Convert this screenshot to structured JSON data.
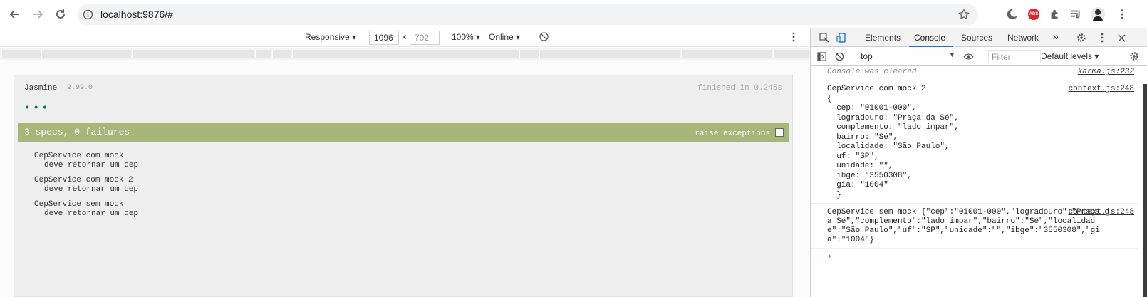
{
  "browser": {
    "url": "localhost:9876/#",
    "icons": [
      "back-icon",
      "forward-icon",
      "reload-icon",
      "info-icon",
      "star-icon",
      "dark-mode-icon",
      "adblock-icon",
      "extensions-icon",
      "media-icon",
      "profile-avatar",
      "menu-icon"
    ],
    "adblock_label": "ADS"
  },
  "device_toolbar": {
    "mode": "Responsive",
    "width": "1096",
    "times": "×",
    "height": "702",
    "zoom": "100%",
    "network": "Online"
  },
  "jasmine": {
    "brand": "Jasmine",
    "version": "2.99.0",
    "duration": "finished in 0.245s",
    "dots": "•••",
    "summary": "3 specs, 0 failures",
    "raise_label": "raise exceptions",
    "suites": [
      {
        "name": "CepService com mock",
        "spec": "deve retornar um cep"
      },
      {
        "name": "CepService com mock 2",
        "spec": "deve retornar um cep"
      },
      {
        "name": "CepService sem mock",
        "spec": "deve retornar um cep"
      }
    ],
    "colors": {
      "bar": "#a6b779",
      "dots": "#007069"
    }
  },
  "devtools": {
    "tabs": [
      "Elements",
      "Console",
      "Sources",
      "Network"
    ],
    "active_tab": "Console",
    "more_tabs": "»",
    "context": "top",
    "filter_placeholder": "Filter",
    "levels": "Default levels",
    "messages": [
      {
        "text": "Console was cleared",
        "source": "karma.js:232"
      },
      {
        "text": "CepService com mock 2\n{\n  cep: \"01001-000\",\n  logradouro: \"Praça da Sé\",\n  complemento: \"lado ímpar\",\n  bairro: \"Sé\",\n  localidade: \"São Paulo\",\n  uf: \"SP\",\n  unidade: \"\",\n  ibge: \"3550308\",\n  gia: \"1004\"\n  }",
        "source": "context.js:248"
      },
      {
        "text": "CepService sem mock {\"cep\":\"01001-000\",\"logradouro\":\"Praça da Sé\",\"complemento\":\"lado ímpar\",\"bairro\":\"Sé\",\"localidade\":\"São Paulo\",\"uf\":\"SP\",\"unidade\":\"\",\"ibge\":\"3550308\",\"gia\":\"1004\"}",
        "source": "context.js:248"
      }
    ],
    "prompt": "›"
  }
}
